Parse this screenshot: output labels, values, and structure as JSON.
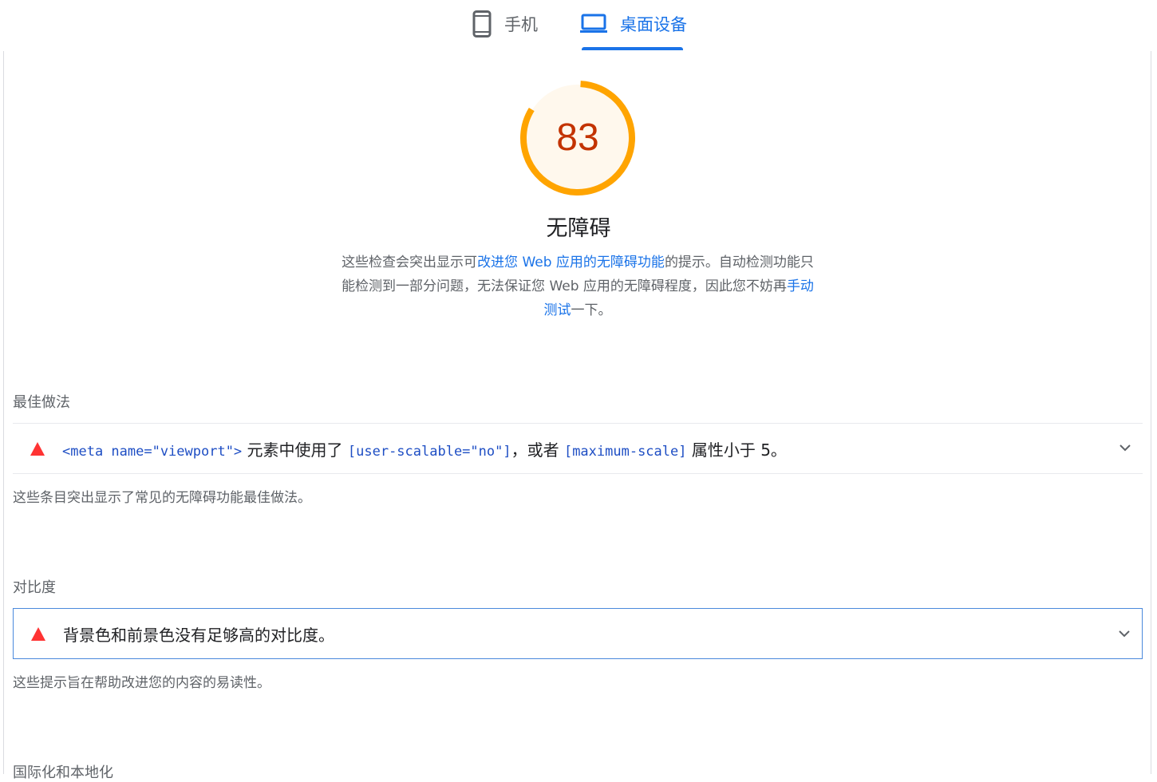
{
  "tabs": [
    {
      "label": "手机",
      "icon": "phone-icon",
      "active": false
    },
    {
      "label": "桌面设备",
      "icon": "laptop-icon",
      "active": true
    }
  ],
  "colors": {
    "accent": "#1a73e8",
    "score_orange": "#ffa400",
    "score_text": "#c33300",
    "fail_red": "#ff3333"
  },
  "score": {
    "value": "83",
    "fraction": 0.83
  },
  "category": {
    "title": "无障碍",
    "desc_part1": "这些检查会突出显示可",
    "desc_link1": "改进您 Web 应用的无障碍功能",
    "desc_part2": "的提示。自动检测功能只能检测到一部分问题，无法保证您 Web 应用的无障碍程度，因此您不妨再",
    "desc_link2": "手动测试",
    "desc_part3": "一下。"
  },
  "groups": [
    {
      "title": "最佳做法",
      "audit": {
        "code1": "<meta name=\"viewport\">",
        "text1": " 元素中使用了 ",
        "code2": "[user-scalable=\"no\"]",
        "text2": "，或者 ",
        "code3": "[maximum-scale]",
        "text3": " 属性小于 5。"
      },
      "description": "这些条目突出显示了常见的无障碍功能最佳做法。"
    },
    {
      "title": "对比度",
      "audit": {
        "text": "背景色和前景色没有足够高的对比度。"
      },
      "description": "这些提示旨在帮助改进您的内容的易读性。"
    },
    {
      "title": "国际化和本地化"
    }
  ]
}
